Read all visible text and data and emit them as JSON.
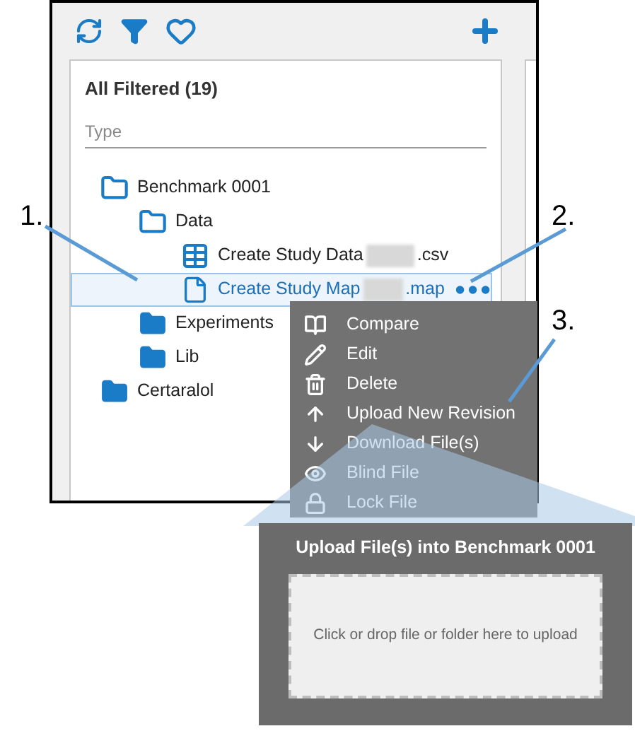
{
  "callouts": [
    "1.",
    "2.",
    "3."
  ],
  "panel": {
    "title": "All Filtered (19)",
    "filter": {
      "placeholder": "Type"
    }
  },
  "tree": [
    {
      "kind": "folder",
      "name": "Benchmark 0001",
      "expanded": true,
      "selected": false,
      "children": [
        {
          "kind": "folder",
          "name": "Data",
          "expanded": true,
          "selected": false,
          "children": [
            {
              "kind": "table",
              "name": "Create Study Data",
              "redacted": true,
              "suffix": ".csv",
              "selected": false
            },
            {
              "kind": "file",
              "name": "Create Study Map",
              "redacted": true,
              "suffix": ".map",
              "selected": true
            }
          ]
        },
        {
          "kind": "folder",
          "name": "Experiments",
          "expanded": false,
          "selected": false
        },
        {
          "kind": "folder",
          "name": "Lib",
          "expanded": false,
          "selected": false
        }
      ]
    },
    {
      "kind": "folder",
      "name": "Certaralol",
      "expanded": false,
      "selected": false
    }
  ],
  "context_menu": [
    "Compare",
    "Edit",
    "Delete",
    "Upload New Revision",
    "Download File(s)",
    "Blind File",
    "Lock File"
  ],
  "upload_dialog": {
    "title": "Upload File(s) into Benchmark 0001",
    "drop_zone": "Click or drop file or folder here to upload"
  }
}
